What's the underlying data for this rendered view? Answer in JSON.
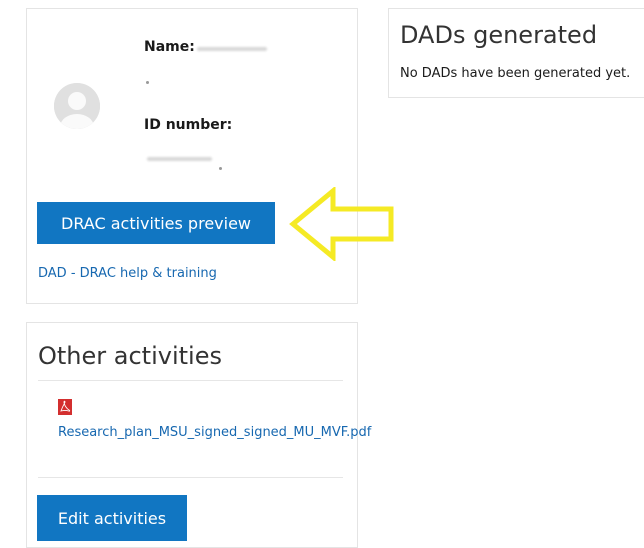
{
  "profile": {
    "name_label": "Name:",
    "id_label": "ID number:",
    "drac_button_label": "DRAC activities preview",
    "help_link_label": "DAD - DRAC help & training"
  },
  "other_activities": {
    "title": "Other activities",
    "file_label": "Research_plan_MSU_signed_signed_MU_MVF.pdf",
    "edit_button_label": "Edit activities"
  },
  "dads": {
    "title": "DADs generated",
    "empty_message": "No DADs have been generated yet."
  },
  "colors": {
    "primary_button": "#1176c2",
    "link": "#1768b0",
    "highlight_arrow": "#f5ea24",
    "pdf_icon": "#d32f2f"
  }
}
